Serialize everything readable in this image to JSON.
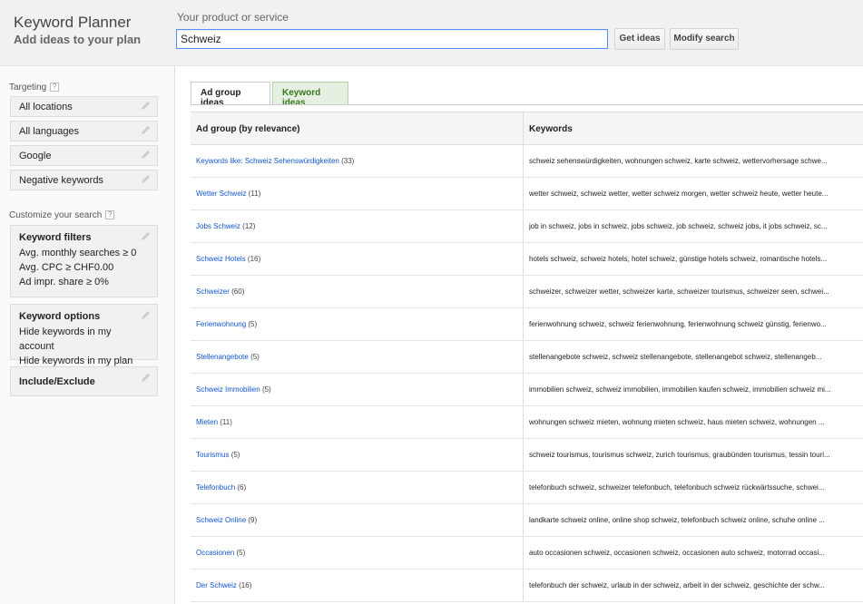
{
  "header": {
    "title": "Keyword Planner",
    "subtitle": "Add ideas to your plan",
    "search_label": "Your product or service",
    "search_value": "Schweiz",
    "get_ideas_label": "Get ideas",
    "modify_search_label": "Modify search"
  },
  "sidebar": {
    "targeting_label": "Targeting",
    "help_glyph": "?",
    "targeting_items": [
      {
        "label": "All locations"
      },
      {
        "label": "All languages"
      },
      {
        "label": "Google"
      },
      {
        "label": "Negative keywords"
      }
    ],
    "customize_label": "Customize your search",
    "keyword_filters": {
      "title": "Keyword filters",
      "lines": [
        "Avg. monthly searches ≥ 0",
        "Avg. CPC ≥ CHF0.00",
        "Ad impr. share ≥ 0%"
      ]
    },
    "keyword_options": {
      "title": "Keyword options",
      "lines": [
        "Hide keywords in my account",
        "Hide keywords in my plan"
      ]
    },
    "include_exclude": {
      "title": "Include/Exclude"
    }
  },
  "tabs": [
    {
      "label": "Ad group ideas",
      "active": true
    },
    {
      "label": "Keyword ideas",
      "active": false
    }
  ],
  "table": {
    "col_adgroup": "Ad group (by relevance)",
    "col_keywords": "Keywords",
    "rows": [
      {
        "name": "Keywords like: Schweiz Sehenswürdigkeiten",
        "count": "(33)",
        "keywords": "schweiz sehenswürdigkeiten, wohnungen schweiz, karte schweiz, wettervorhersage schwe..."
      },
      {
        "name": "Wetter Schweiz",
        "count": "(11)",
        "keywords": "wetter schweiz, schweiz wetter, wetter schweiz morgen, wetter schweiz heute, wetter heute..."
      },
      {
        "name": "Jobs Schweiz",
        "count": "(12)",
        "keywords": "job in schweiz, jobs in schweiz, jobs schweiz, job schweiz, schweiz jobs, it jobs schweiz, sc..."
      },
      {
        "name": "Schweiz Hotels",
        "count": "(16)",
        "keywords": "hotels schweiz, schweiz hotels, hotel schweiz, günstige hotels schweiz, romantische hotels..."
      },
      {
        "name": "Schweizer",
        "count": "(60)",
        "keywords": "schweizer, schweizer wetter, schweizer karte, schweizer tourismus, schweizer seen, schwei..."
      },
      {
        "name": "Ferienwohnung",
        "count": "(5)",
        "keywords": "ferienwohnung schweiz, schweiz ferienwohnung, ferienwohnung schweiz günstig, ferienwo..."
      },
      {
        "name": "Stellenangebote",
        "count": "(5)",
        "keywords": "stellenangebote schweiz, schweiz stellenangebote, stellenangebot schweiz, stellenangeb..."
      },
      {
        "name": "Schweiz Immobilien",
        "count": "(5)",
        "keywords": "immobilien schweiz, schweiz immobilien, immobilien kaufen schweiz, immobilien schweiz mi..."
      },
      {
        "name": "Mieten",
        "count": "(11)",
        "keywords": "wohnungen schweiz mieten, wohnung mieten schweiz, haus mieten schweiz, wohnungen ..."
      },
      {
        "name": "Tourismus",
        "count": "(5)",
        "keywords": "schweiz tourismus, tourismus schweiz, zurich tourismus, graubünden tourismus, tessin touri..."
      },
      {
        "name": "Telefonbuch",
        "count": "(6)",
        "keywords": "telefonbuch schweiz, schweizer telefonbuch, telefonbuch schweiz rückwärtssuche, schwei..."
      },
      {
        "name": "Schweiz Online",
        "count": "(9)",
        "keywords": "landkarte schweiz online, online shop schweiz, telefonbuch schweiz online, schuhe online ..."
      },
      {
        "name": "Occasionen",
        "count": "(5)",
        "keywords": "auto occasionen schweiz, occasionen schweiz, occasionen auto schweiz, motorrad occasi..."
      },
      {
        "name": "Der Schweiz",
        "count": "(16)",
        "keywords": "telefonbuch der schweiz, urlaub in der schweiz, arbeit in der schweiz, geschichte der schw..."
      }
    ]
  },
  "colors": {
    "link": "#1155cc",
    "active_input_border": "#4d90fe",
    "keyword_tab_bg": "#e5f0e2",
    "keyword_tab_text": "#38761d"
  }
}
